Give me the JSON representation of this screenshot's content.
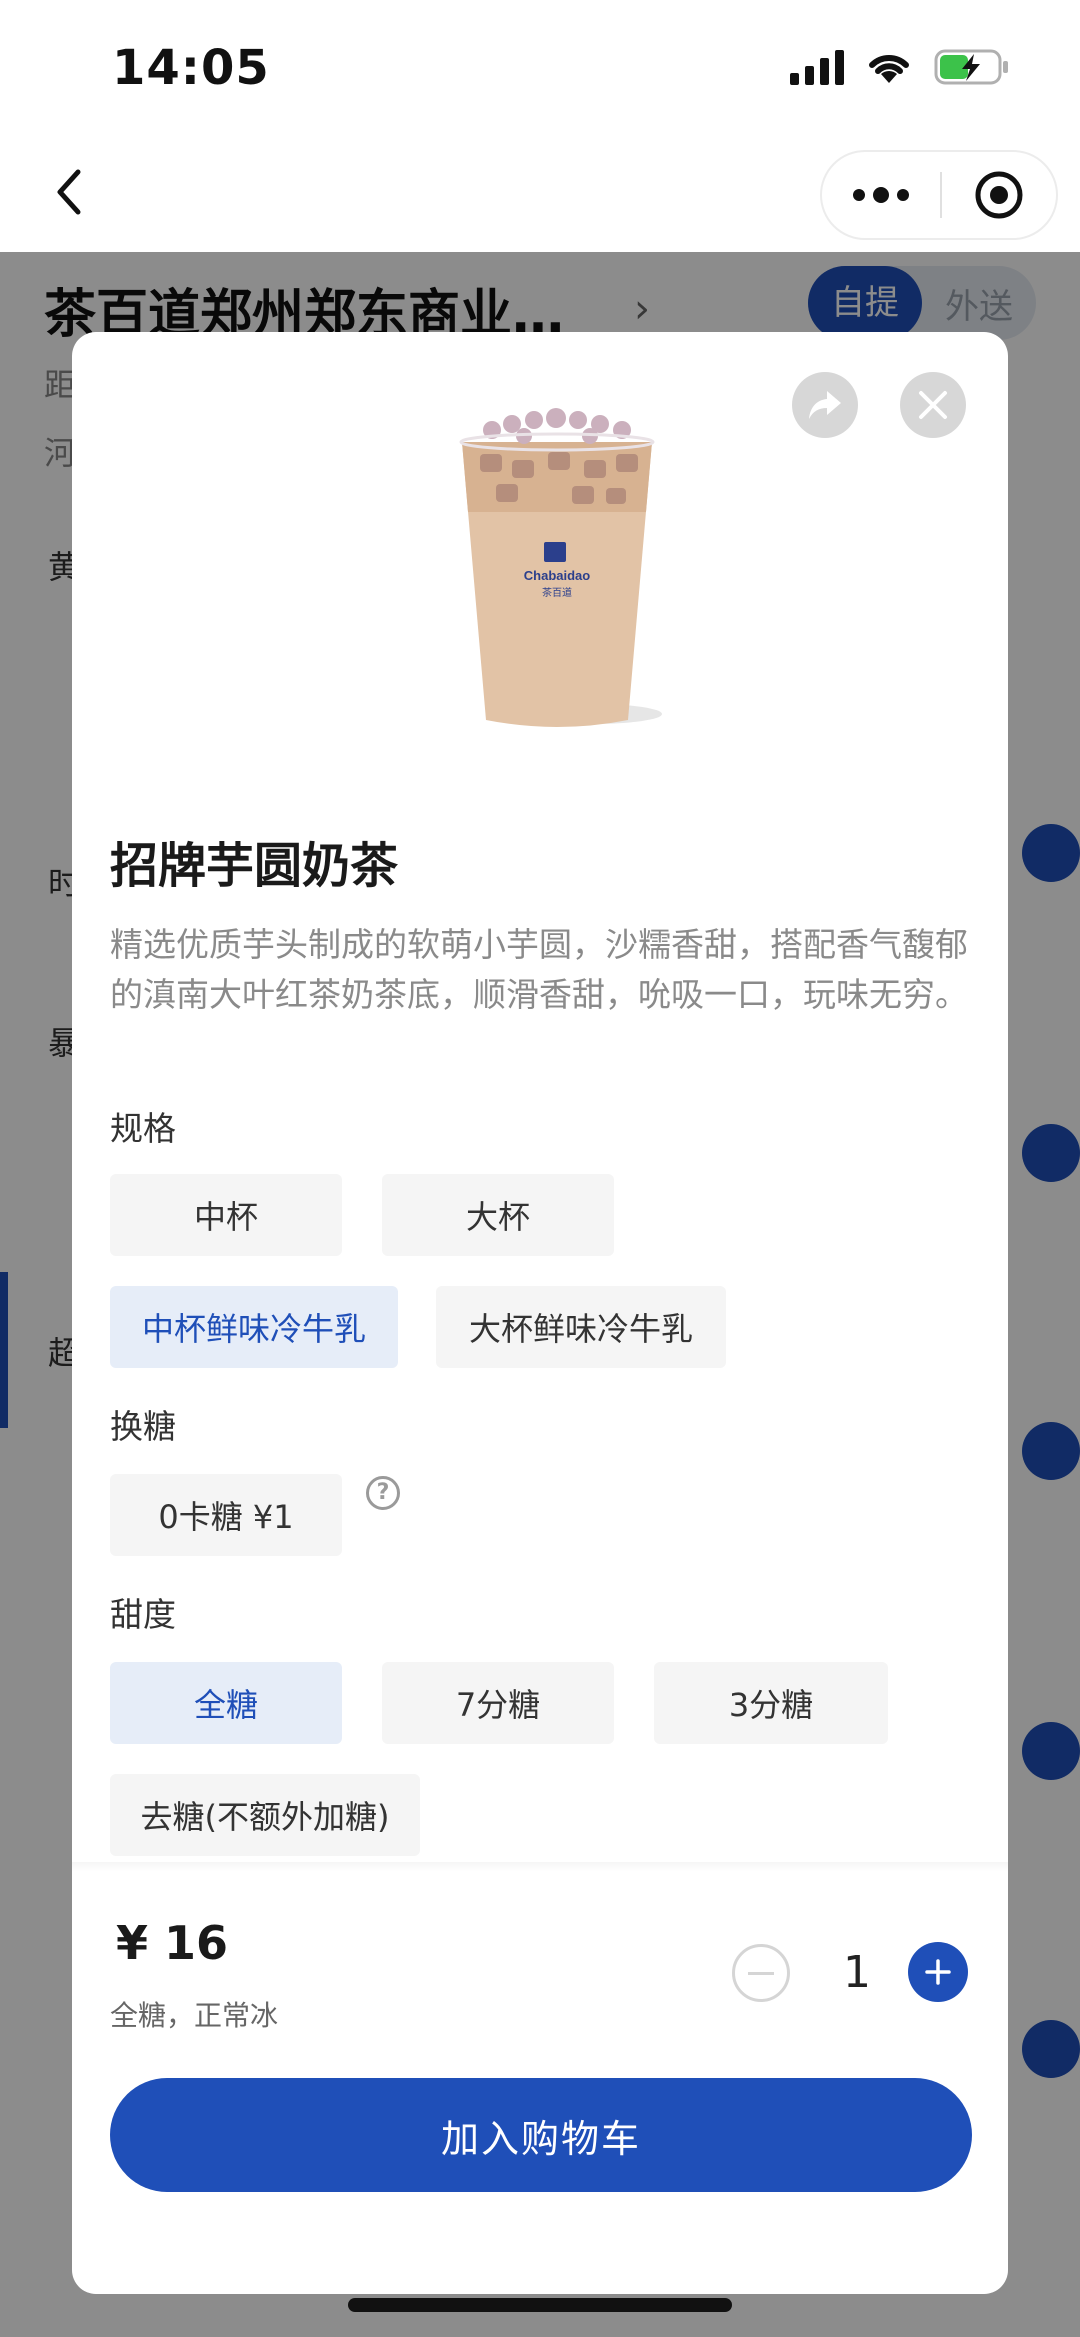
{
  "status_bar": {
    "time": "14:05"
  },
  "store": {
    "title": "茶百道郑州郑东商业…",
    "distance_prefix": "距",
    "address_prefix": "河",
    "modes": [
      "自提",
      "外送"
    ],
    "categories": [
      "黄",
      "时",
      "暴",
      "超"
    ]
  },
  "product": {
    "name": "招牌芋圆奶茶",
    "description": "精选优质芋头制成的软萌小芋圆，沙糯香甜，搭配香气馥郁的滇南大叶红茶奶茶底，顺滑香甜，吮吸一口，玩味无穷。",
    "cup_brand": "Chabaidao",
    "cup_brand_cn": "茶百道"
  },
  "sections": {
    "size": {
      "label": "规格",
      "options": [
        "中杯",
        "大杯",
        "中杯鲜味冷牛乳",
        "大杯鲜味冷牛乳"
      ],
      "selected": "中杯鲜味冷牛乳"
    },
    "sugar_swap": {
      "label": "换糖",
      "options": [
        "0卡糖  ¥1"
      ],
      "help": "?"
    },
    "sweetness": {
      "label": "甜度",
      "options": [
        "全糖",
        "7分糖",
        "3分糖",
        "去糖(不额外加糖)"
      ],
      "selected": "全糖"
    }
  },
  "footer": {
    "price": "¥ 16",
    "summary": "全糖，正常冰",
    "quantity": "1",
    "add_to_cart": "加入购物车"
  },
  "colors": {
    "accent": "#1f4fb8",
    "selected_bg": "#e6edf8",
    "option_bg": "#f5f5f5"
  }
}
